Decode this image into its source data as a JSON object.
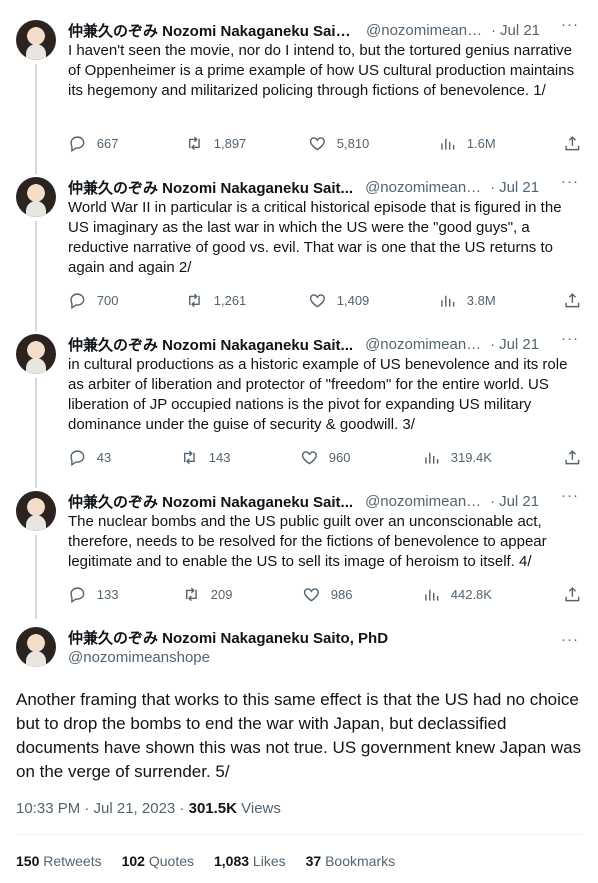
{
  "author": {
    "name_short": "仲兼久のぞみ Nozomi Nakaganeku Saitо...",
    "name_full": "仲兼久のぞみ Nozomi Nakaganeku Saito, PhD",
    "handle_short": "@nozomimeans...",
    "handle_full": "@nozomimeanshope"
  },
  "thread": [
    {
      "name": "仲兼久のぞみ Nozomi Nakaganeku Saito...",
      "handle": "@nozomimeans...",
      "date": "Jul 21",
      "text": "I haven't seen the movie, nor do I intend to, but the tortured genius narrative of Oppenheimer is a prime example of how US cultural production maintains its hegemony and militarized policing through fictions of benevolence. 1/",
      "replies": "667",
      "retweets": "1,897",
      "likes": "5,810",
      "views": "1.6M"
    },
    {
      "name": "仲兼久のぞみ Nozomi Nakaganeku Sait...",
      "handle": "@nozomimeans...",
      "date": "Jul 21",
      "text": "World War II in particular is a critical historical episode that is figured in the US imaginary as the last war in which the US were the \"good guys\", a reductive narrative of good vs. evil. That war is one that the US returns to again and again 2/",
      "replies": "700",
      "retweets": "1,261",
      "likes": "1,409",
      "views": "3.8M"
    },
    {
      "name": "仲兼久のぞみ Nozomi Nakaganeku Sait...",
      "handle": "@nozomimeans...",
      "date": "Jul 21",
      "text": "in cultural productions as a historic example of US benevolence and its role as arbiter of liberation and protector of \"freedom\" for the entire world. US liberation of JP occupied nations is the pivot for expanding US military dominance under the guise of security & goodwill. 3/",
      "replies": "43",
      "retweets": "143",
      "likes": "960",
      "views": "319.4K"
    },
    {
      "name": "仲兼久のぞみ Nozomi Nakaganeku Sait...",
      "handle": "@nozomimeans...",
      "date": "Jul 21",
      "text": "The nuclear bombs and the US public guilt over an unconscionable act, therefore, needs to be resolved for the fictions of benevolence to appear legitimate and to enable the US to sell its image of heroism to itself. 4/",
      "replies": "133",
      "retweets": "209",
      "likes": "986",
      "views": "442.8K"
    }
  ],
  "main_tweet": {
    "text": "Another framing that works to this same effect is that the US had no choice but to drop the bombs to end the war with Japan, but declassified documents have shown this was not true. US government knew Japan was on the verge of surrender. 5/",
    "time": "10:33 PM · Jul 21, 2023 · ",
    "views_count": "301.5K",
    "views_label": " Views",
    "retweets_count": "150",
    "retweets_label": " Retweets",
    "quotes_count": "102",
    "quotes_label": " Quotes",
    "likes_count": "1,083",
    "likes_label": " Likes",
    "bookmarks_count": "37",
    "bookmarks_label": " Bookmarks"
  },
  "more_glyph": "···",
  "date_separator": "·",
  "icons": [
    "reply-icon",
    "retweet-icon",
    "like-icon",
    "views-icon",
    "share-icon",
    "more-icon"
  ]
}
